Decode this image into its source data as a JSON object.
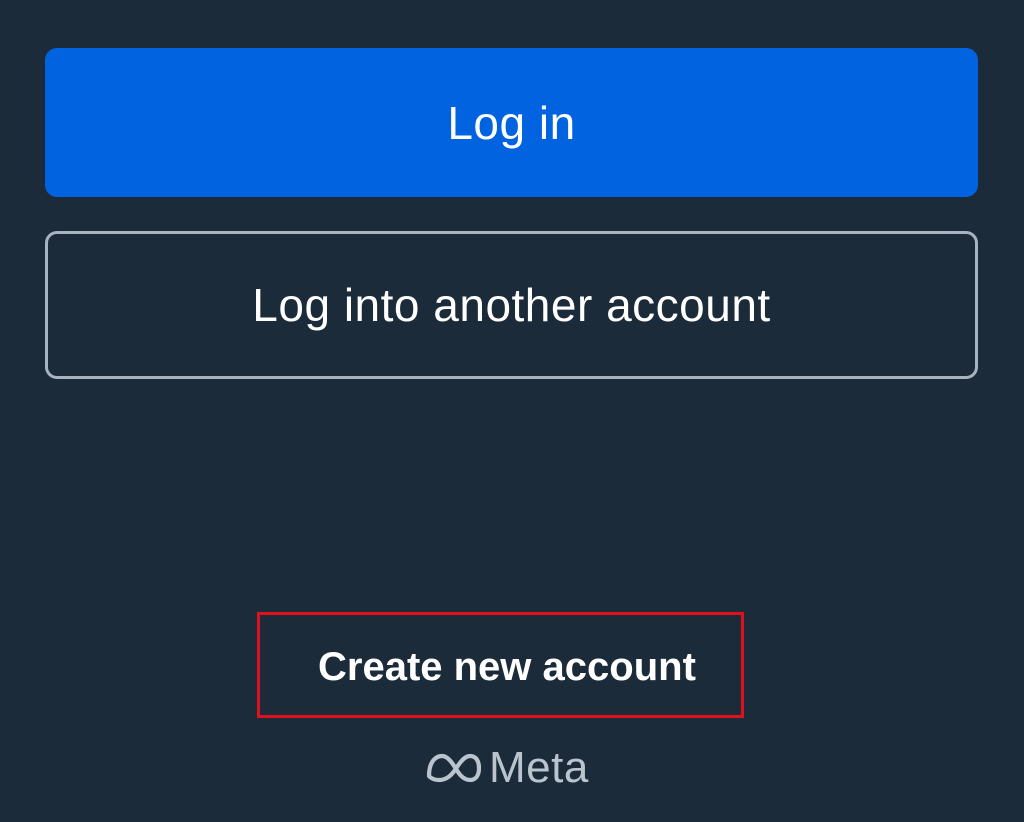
{
  "actions": {
    "login_label": "Log in",
    "login_other_label": "Log into another account",
    "create_account_label": "Create new account"
  },
  "footer": {
    "brand_icon": "meta-infinity-logo",
    "brand_name": "Meta"
  },
  "colors": {
    "background": "#1c2b39",
    "primary_button": "#0263e0",
    "outline_border": "#a7b3bf",
    "highlight": "#e0101d",
    "brand_text": "#b9c4cf"
  }
}
